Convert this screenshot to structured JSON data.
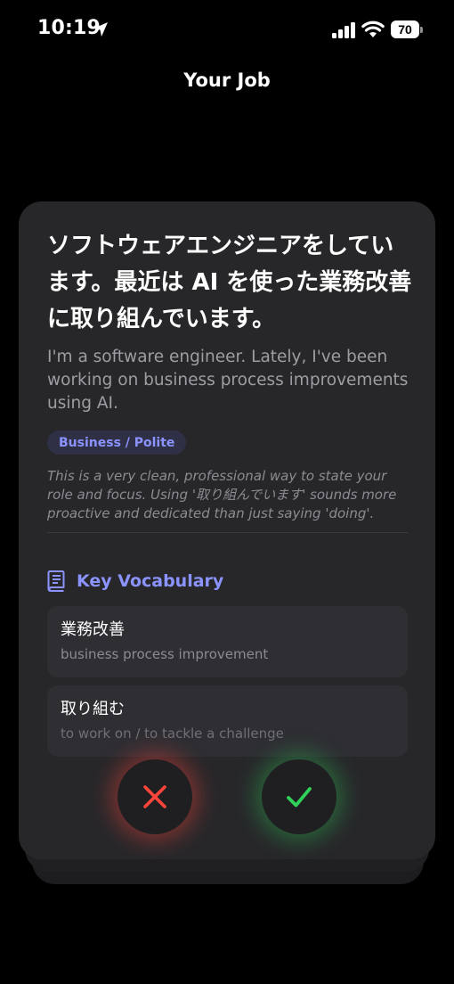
{
  "status_bar": {
    "time": "10:19",
    "battery": "70"
  },
  "header": {
    "title": "Your Job"
  },
  "card": {
    "japanese": "ソフトウェアエンジニアをしています。最近は AI を使った業務改善に取り組んでいます。",
    "english": "I'm a software engineer. Lately, I've been working on business process improvements using AI.",
    "tag": "Business / Polite",
    "note": "This is a very clean, professional way to state your role and focus. Using '取り組んでいます' sounds more proactive and dedicated than just saying 'doing'.",
    "vocab_title": "Key Vocabulary",
    "vocab": [
      {
        "word": "業務改善",
        "meaning": "business process improvement"
      },
      {
        "word": "取り組む",
        "meaning": "to work on / to tackle a challenge"
      }
    ]
  },
  "icons": {
    "reject": "close-icon",
    "accept": "checkmark-icon",
    "vocab": "book-icon"
  },
  "colors": {
    "accent": "#8b93ff",
    "reject": "#ff453a",
    "accept": "#30d158",
    "card": "#27272a"
  }
}
